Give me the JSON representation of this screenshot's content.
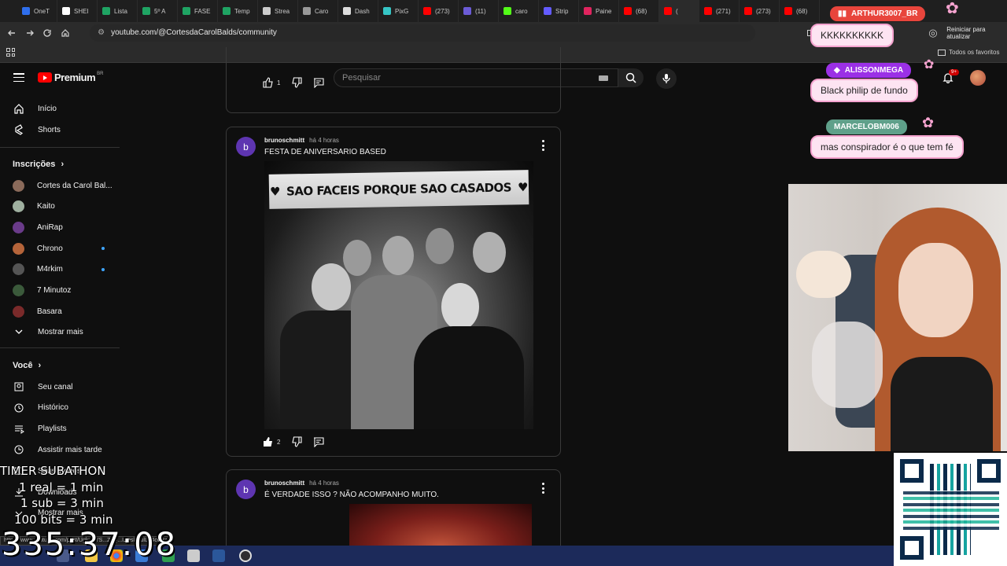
{
  "browser": {
    "tabs": [
      {
        "label": "OneT",
        "color": "#2f6fed"
      },
      {
        "label": "SHEI",
        "color": "#ffffff"
      },
      {
        "label": "Lista",
        "color": "#1fa463"
      },
      {
        "label": "5º A",
        "color": "#1fa463"
      },
      {
        "label": "FASE",
        "color": "#1fa463"
      },
      {
        "label": "Temp",
        "color": "#1fa463"
      },
      {
        "label": "Strea",
        "color": "#cccccc"
      },
      {
        "label": "Caro",
        "color": "#999999"
      },
      {
        "label": "Dash",
        "color": "#dddddd"
      },
      {
        "label": "PixG",
        "color": "#36c5c5"
      },
      {
        "label": "(273)",
        "color": "#ff0000"
      },
      {
        "label": "(11)",
        "color": "#6b5bd6"
      },
      {
        "label": "caro",
        "color": "#53fc18"
      },
      {
        "label": "Strip",
        "color": "#635bff"
      },
      {
        "label": "Paine",
        "color": "#e0245e"
      },
      {
        "label": "(68)",
        "color": "#ff0000"
      },
      {
        "label": "(",
        "color": "#ff0000"
      },
      {
        "label": "(271)",
        "color": "#ff0000"
      },
      {
        "label": "(273)",
        "color": "#ff0000"
      },
      {
        "label": "(68)",
        "color": "#ff0000"
      }
    ],
    "url": "youtube.com/@CortesdaCarolBalds/community",
    "restart_label": "Reiniciar para atualizar",
    "bookmarks_label": "Todos os favoritos"
  },
  "youtube": {
    "logo_label": "Premium",
    "logo_region": "BR",
    "search_placeholder": "Pesquisar",
    "notif_count": "9+",
    "sidebar": {
      "items_top": [
        "Início",
        "Shorts"
      ],
      "subs_heading": "Inscrições",
      "subscriptions": [
        {
          "label": "Cortes da Carol Bal...",
          "color": "#8a6a5a",
          "live": false
        },
        {
          "label": "Kaito",
          "color": "#9fb0a0",
          "live": false
        },
        {
          "label": "AniRap",
          "color": "#6a3b8a",
          "live": false
        },
        {
          "label": "Chrono",
          "color": "#b5643a",
          "live": true
        },
        {
          "label": "M4rkim",
          "color": "#555555",
          "live": true
        },
        {
          "label": "7 Minutoz",
          "color": "#3b5a3b",
          "live": false
        },
        {
          "label": "Basara",
          "color": "#7a2a2a",
          "live": false
        }
      ],
      "show_more": "Mostrar mais",
      "you_heading": "Você",
      "you_items": [
        "Seu canal",
        "Histórico",
        "Playlists",
        "Assistir mais tarde",
        "Seus vídeos",
        "Downloads",
        "Mostrar mais"
      ]
    },
    "posts": [
      {
        "likes": "1"
      },
      {
        "avatar_letter": "b",
        "author": "brunoschmitt",
        "time": "há 4 horas",
        "text": "FESTA DE ANIVERSARIO BASED",
        "banner": "SAO FACEIS PORQUE SAO CASADOS",
        "likes": "2"
      },
      {
        "avatar_letter": "b",
        "author": "brunoschmitt",
        "time": "há 4 horas",
        "text": "É VERDADE ISSO ? NÃO ACOMPANHO MUITO."
      }
    ]
  },
  "stream": {
    "chat": [
      {
        "user": "ARTHUR3007_BR",
        "message": "KKKKKKKKKK",
        "name_color": "#e8453c"
      },
      {
        "user": "ALISSONMEGA",
        "message": "Black philip de fundo",
        "name_color": "#9b30e6"
      },
      {
        "user": "MARCELOBM006",
        "message": "mas conspirador é o que tem fé",
        "name_color": "#5fa08a"
      }
    ],
    "timer_lines": [
      "TIMER SUBATHON",
      "1 real = 1 min",
      "1 sub = 3 min",
      "100 bits = 3 min"
    ],
    "timer_value": "335:37:08",
    "status_url": "https://www.youtube.com/post/UgkxCYS...ZJQ...IDpsl4vulLA4cw8z"
  }
}
